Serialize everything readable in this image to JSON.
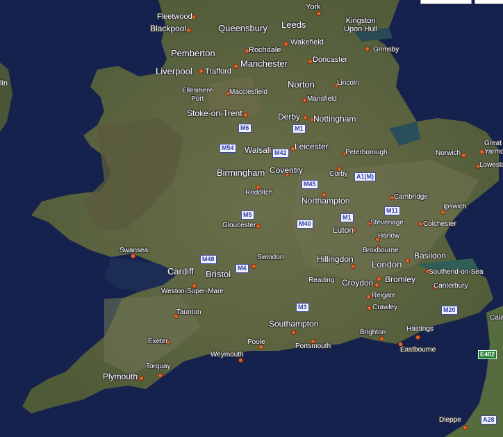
{
  "map": {
    "colors": {
      "sea": "#16224e",
      "land": "#5f6a43",
      "land_dark": "#4b5535",
      "land_light": "#7d7d5e",
      "dot": "#e0672c",
      "shield_text": "#2f3ea8"
    },
    "cities": {
      "york": "York",
      "fleetwood": "Fleetwood",
      "blackpool": "Blackpool",
      "queensbury": "Queensbury",
      "leeds": "Leeds",
      "kingston": "Kingston\nUpon Hull",
      "wakefield": "Wakefield",
      "grimsby": "Grimsby",
      "rochdale": "Rochdale",
      "pemberton": "Pemberton",
      "manchester": "Manchester",
      "doncaster": "Doncaster",
      "liverpool": "Liverpool",
      "trafford": "Trafford",
      "lin": "lin",
      "norton": "Norton",
      "lincoln": "Lincoln",
      "ellesmere": "Ellesmere\nPort",
      "macclesfield": "Macclesfield",
      "mansfield": "Mansfield",
      "stoke": "Stoke-on-Trent",
      "derby": "Derby",
      "nottingham": "Nottingham",
      "walsall": "Walsall",
      "leicester": "Leicester",
      "peterborough": "Peterborough",
      "norwich": "Norwich",
      "great_yarmouth": "Great\nYarmouth",
      "birmingham": "Birmingham",
      "coventry": "Coventry",
      "corby": "Corby",
      "lowestoft": "Lowesto",
      "redditch": "Redditch",
      "cambridge": "Cambridge",
      "northampton": "Northampton",
      "ipswich": "Ipswich",
      "gloucester": "Gloucester",
      "stevenage": "Stevenage",
      "colchester": "Colchester",
      "luton": "Luton",
      "harlow": "Harlow",
      "swansea": "Swansea",
      "broxbourne": "Broxbourne",
      "basildon": "Basildon",
      "cardiff": "Cardiff",
      "bristol": "Bristol",
      "swindon": "Swindon",
      "hillingdon": "Hillingdon",
      "london": "London",
      "southend": "Southend-on-Sea",
      "reading": "Reading",
      "croydon": "Croydon",
      "bromley": "Bromley",
      "weston": "Weston-Super-Mare",
      "canterbury": "Canterbury",
      "reigate": "Reigate",
      "crawley": "Crawley",
      "taunton": "Taunton",
      "hastings": "Hastings",
      "southampton": "Southampton",
      "brighton": "Brighton",
      "exeter": "Exeter",
      "poole": "Poole",
      "portsmouth": "Portsmouth",
      "eastbourne": "Eastbourne",
      "weymouth": "Weymouth",
      "torquay": "Torquay",
      "plymouth": "Plymouth",
      "dieppe": "Dieppe",
      "calais": "Cala"
    },
    "roads": {
      "m6": "M6",
      "m54": "M54",
      "m42": "M42",
      "a1m": "A1(M)",
      "m45": "M45",
      "m11": "M11",
      "m1": "M1",
      "m1b": "M1",
      "m5": "M5",
      "m40": "M40",
      "m48": "M48",
      "m4": "M4",
      "m3": "M3",
      "m20": "M20",
      "e402": "E402",
      "a28": "A28"
    }
  }
}
